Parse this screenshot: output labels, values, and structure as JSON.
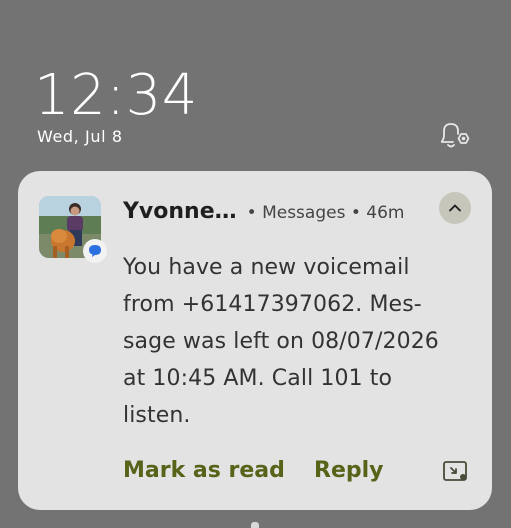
{
  "lockscreen": {
    "time": "12:34",
    "date": "Wed, Jul 8",
    "bell_icon": "notification-settings-icon"
  },
  "notification": {
    "sender": "Yvonne…",
    "app_meta": "• Messages • 46m",
    "body": "You have a new voicemail from +61417397062. Mes-sage was left on 08/07/2026 at 10:45 AM. Call 101 to listen.",
    "body_lines": [
      "You have a new voicemail",
      "from +61417397062. Mes-",
      "sage was left on 08/07/2026",
      "at 10:45 AM. Call 101 to",
      "listen."
    ],
    "actions": {
      "mark_as_read": "Mark as read",
      "reply": "Reply"
    },
    "icons": {
      "avatar": "contact-photo",
      "badge": "messages-app-icon",
      "collapse": "chevron-up-icon",
      "picture_in_picture": "picture-in-picture-icon"
    },
    "colors": {
      "card_bg": "#e3e3e3",
      "action_text": "#566318",
      "background": "#737373"
    }
  }
}
